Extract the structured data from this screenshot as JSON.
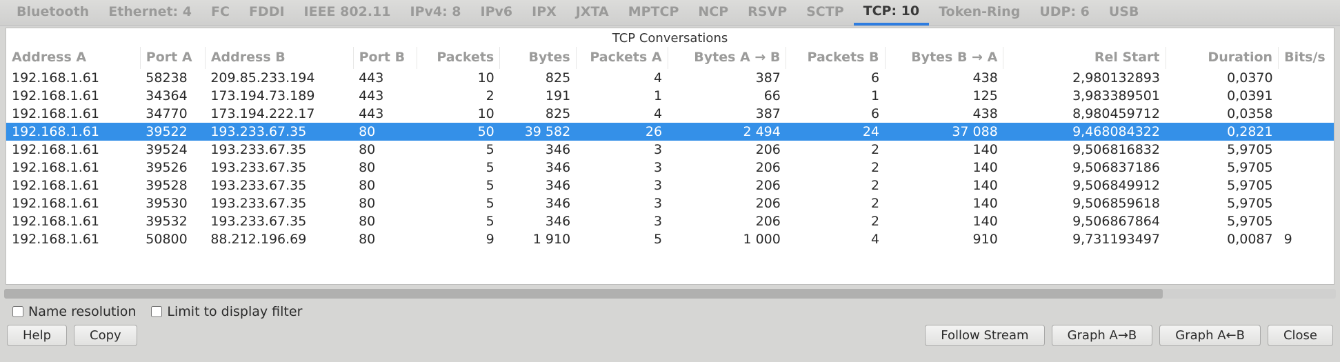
{
  "tabs": [
    {
      "label": "Bluetooth",
      "active": false
    },
    {
      "label": "Ethernet: 4",
      "active": false
    },
    {
      "label": "FC",
      "active": false
    },
    {
      "label": "FDDI",
      "active": false
    },
    {
      "label": "IEEE 802.11",
      "active": false
    },
    {
      "label": "IPv4: 8",
      "active": false
    },
    {
      "label": "IPv6",
      "active": false
    },
    {
      "label": "IPX",
      "active": false
    },
    {
      "label": "JXTA",
      "active": false
    },
    {
      "label": "MPTCP",
      "active": false
    },
    {
      "label": "NCP",
      "active": false
    },
    {
      "label": "RSVP",
      "active": false
    },
    {
      "label": "SCTP",
      "active": false
    },
    {
      "label": "TCP: 10",
      "active": true
    },
    {
      "label": "Token-Ring",
      "active": false
    },
    {
      "label": "UDP: 6",
      "active": false
    },
    {
      "label": "USB",
      "active": false
    }
  ],
  "panel_title": "TCP Conversations",
  "columns": [
    {
      "key": "addr_a",
      "label": "Address A",
      "align": "left"
    },
    {
      "key": "port_a",
      "label": "Port A",
      "align": "left"
    },
    {
      "key": "addr_b",
      "label": "Address B",
      "align": "left"
    },
    {
      "key": "port_b",
      "label": "Port B",
      "align": "left"
    },
    {
      "key": "packets",
      "label": "Packets",
      "align": "right"
    },
    {
      "key": "bytes",
      "label": "Bytes",
      "align": "right"
    },
    {
      "key": "pkts_a",
      "label": "Packets A",
      "align": "right"
    },
    {
      "key": "bytes_ab",
      "label": "Bytes A → B",
      "align": "right"
    },
    {
      "key": "pkts_b",
      "label": "Packets B",
      "align": "right"
    },
    {
      "key": "bytes_ba",
      "label": "Bytes B → A",
      "align": "right"
    },
    {
      "key": "rel_start",
      "label": "Rel Start",
      "align": "right"
    },
    {
      "key": "duration",
      "label": "Duration",
      "align": "right"
    },
    {
      "key": "bits",
      "label": "Bits/s",
      "align": "left"
    }
  ],
  "rows": [
    {
      "selected": false,
      "addr_a": "192.168.1.61",
      "port_a": "58238",
      "addr_b": "209.85.233.194",
      "port_b": "443",
      "packets": "10",
      "bytes": "825",
      "pkts_a": "4",
      "bytes_ab": "387",
      "pkts_b": "6",
      "bytes_ba": "438",
      "rel_start": "2,980132893",
      "duration": "0,0370",
      "bits": ""
    },
    {
      "selected": false,
      "addr_a": "192.168.1.61",
      "port_a": "34364",
      "addr_b": "173.194.73.189",
      "port_b": "443",
      "packets": "2",
      "bytes": "191",
      "pkts_a": "1",
      "bytes_ab": "66",
      "pkts_b": "1",
      "bytes_ba": "125",
      "rel_start": "3,983389501",
      "duration": "0,0391",
      "bits": ""
    },
    {
      "selected": false,
      "addr_a": "192.168.1.61",
      "port_a": "34770",
      "addr_b": "173.194.222.17",
      "port_b": "443",
      "packets": "10",
      "bytes": "825",
      "pkts_a": "4",
      "bytes_ab": "387",
      "pkts_b": "6",
      "bytes_ba": "438",
      "rel_start": "8,980459712",
      "duration": "0,0358",
      "bits": ""
    },
    {
      "selected": true,
      "addr_a": "192.168.1.61",
      "port_a": "39522",
      "addr_b": "193.233.67.35",
      "port_b": "80",
      "packets": "50",
      "bytes": "39 582",
      "pkts_a": "26",
      "bytes_ab": "2 494",
      "pkts_b": "24",
      "bytes_ba": "37 088",
      "rel_start": "9,468084322",
      "duration": "0,2821",
      "bits": ""
    },
    {
      "selected": false,
      "addr_a": "192.168.1.61",
      "port_a": "39524",
      "addr_b": "193.233.67.35",
      "port_b": "80",
      "packets": "5",
      "bytes": "346",
      "pkts_a": "3",
      "bytes_ab": "206",
      "pkts_b": "2",
      "bytes_ba": "140",
      "rel_start": "9,506816832",
      "duration": "5,9705",
      "bits": ""
    },
    {
      "selected": false,
      "addr_a": "192.168.1.61",
      "port_a": "39526",
      "addr_b": "193.233.67.35",
      "port_b": "80",
      "packets": "5",
      "bytes": "346",
      "pkts_a": "3",
      "bytes_ab": "206",
      "pkts_b": "2",
      "bytes_ba": "140",
      "rel_start": "9,506837186",
      "duration": "5,9705",
      "bits": ""
    },
    {
      "selected": false,
      "addr_a": "192.168.1.61",
      "port_a": "39528",
      "addr_b": "193.233.67.35",
      "port_b": "80",
      "packets": "5",
      "bytes": "346",
      "pkts_a": "3",
      "bytes_ab": "206",
      "pkts_b": "2",
      "bytes_ba": "140",
      "rel_start": "9,506849912",
      "duration": "5,9705",
      "bits": ""
    },
    {
      "selected": false,
      "addr_a": "192.168.1.61",
      "port_a": "39530",
      "addr_b": "193.233.67.35",
      "port_b": "80",
      "packets": "5",
      "bytes": "346",
      "pkts_a": "3",
      "bytes_ab": "206",
      "pkts_b": "2",
      "bytes_ba": "140",
      "rel_start": "9,506859618",
      "duration": "5,9705",
      "bits": ""
    },
    {
      "selected": false,
      "addr_a": "192.168.1.61",
      "port_a": "39532",
      "addr_b": "193.233.67.35",
      "port_b": "80",
      "packets": "5",
      "bytes": "346",
      "pkts_a": "3",
      "bytes_ab": "206",
      "pkts_b": "2",
      "bytes_ba": "140",
      "rel_start": "9,506867864",
      "duration": "5,9705",
      "bits": ""
    },
    {
      "selected": false,
      "addr_a": "192.168.1.61",
      "port_a": "50800",
      "addr_b": "88.212.196.69",
      "port_b": "80",
      "packets": "9",
      "bytes": "1 910",
      "pkts_a": "5",
      "bytes_ab": "1 000",
      "pkts_b": "4",
      "bytes_ba": "910",
      "rel_start": "9,731193497",
      "duration": "0,0087",
      "bits": "9"
    }
  ],
  "options": {
    "name_resolution_label": "Name resolution",
    "name_resolution_checked": false,
    "limit_filter_label": "Limit to display filter",
    "limit_filter_checked": false
  },
  "buttons": {
    "help": "Help",
    "copy": "Copy",
    "follow": "Follow Stream",
    "graph_ab": "Graph A→B",
    "graph_ba": "Graph A←B",
    "close": "Close"
  }
}
